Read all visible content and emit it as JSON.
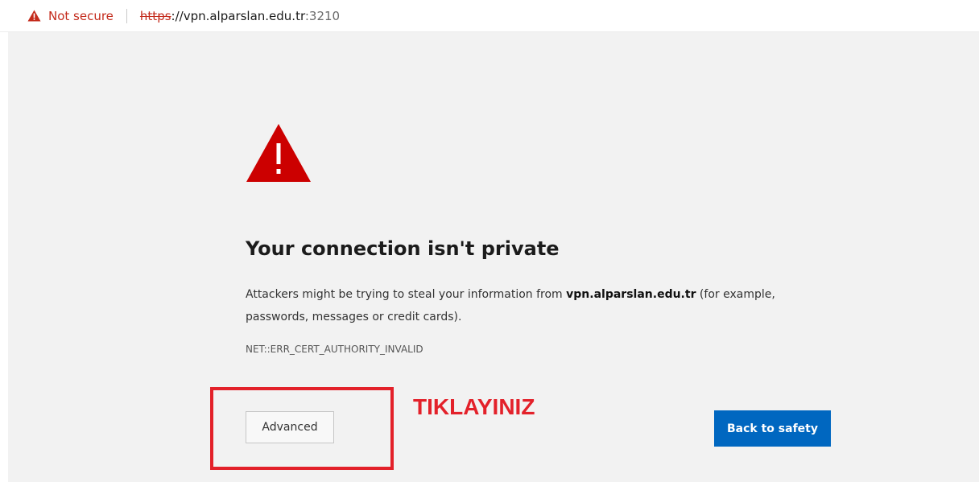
{
  "address_bar": {
    "security_label": "Not secure",
    "url_scheme": "https",
    "url_rest": "://vpn.alparslan.edu.tr",
    "url_port": ":3210",
    "warning_icon": "warning-triangle-icon",
    "warning_color": "#c42b1c"
  },
  "error_page": {
    "icon": "warning-triangle-icon",
    "icon_color": "#cc0000",
    "title": "Your connection isn't private",
    "description_before": "Attackers might be trying to steal your information from ",
    "description_host": "vpn.alparslan.edu.tr",
    "description_after": " (for example, passwords, messages or credit cards).",
    "error_code": "NET::ERR_CERT_AUTHORITY_INVALID",
    "advanced_label": "Advanced",
    "back_label": "Back to safety",
    "primary_color": "#0067c0"
  },
  "annotation": {
    "text": "TIKLAYINIZ",
    "color": "#e3212a"
  }
}
